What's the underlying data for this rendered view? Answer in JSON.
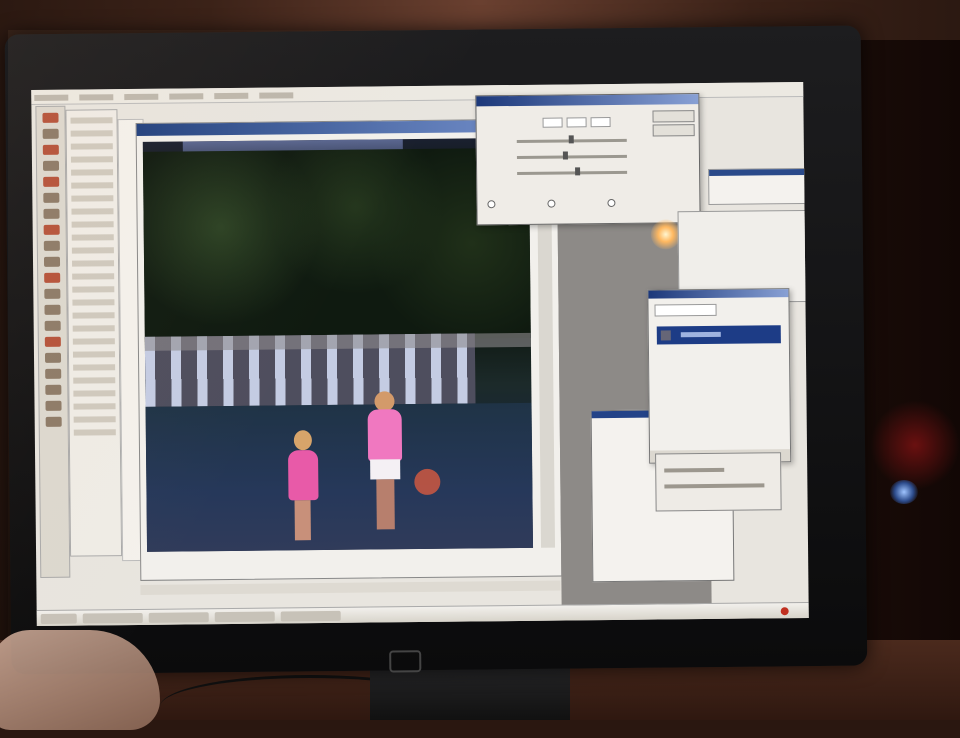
{
  "scene": {
    "description_type": "photo of a monitor showing an image editor",
    "monitor_brand_mark": "hp"
  },
  "colors": {
    "titlebar": "#1e3a7a",
    "selected_layer": "#1d3c86",
    "lens_flare": "#ffb860",
    "power_led": "#9fc4ff"
  },
  "icons": {
    "monitor_logo": "hp-logo-icon",
    "tray_alert": "red-tray-icon"
  }
}
